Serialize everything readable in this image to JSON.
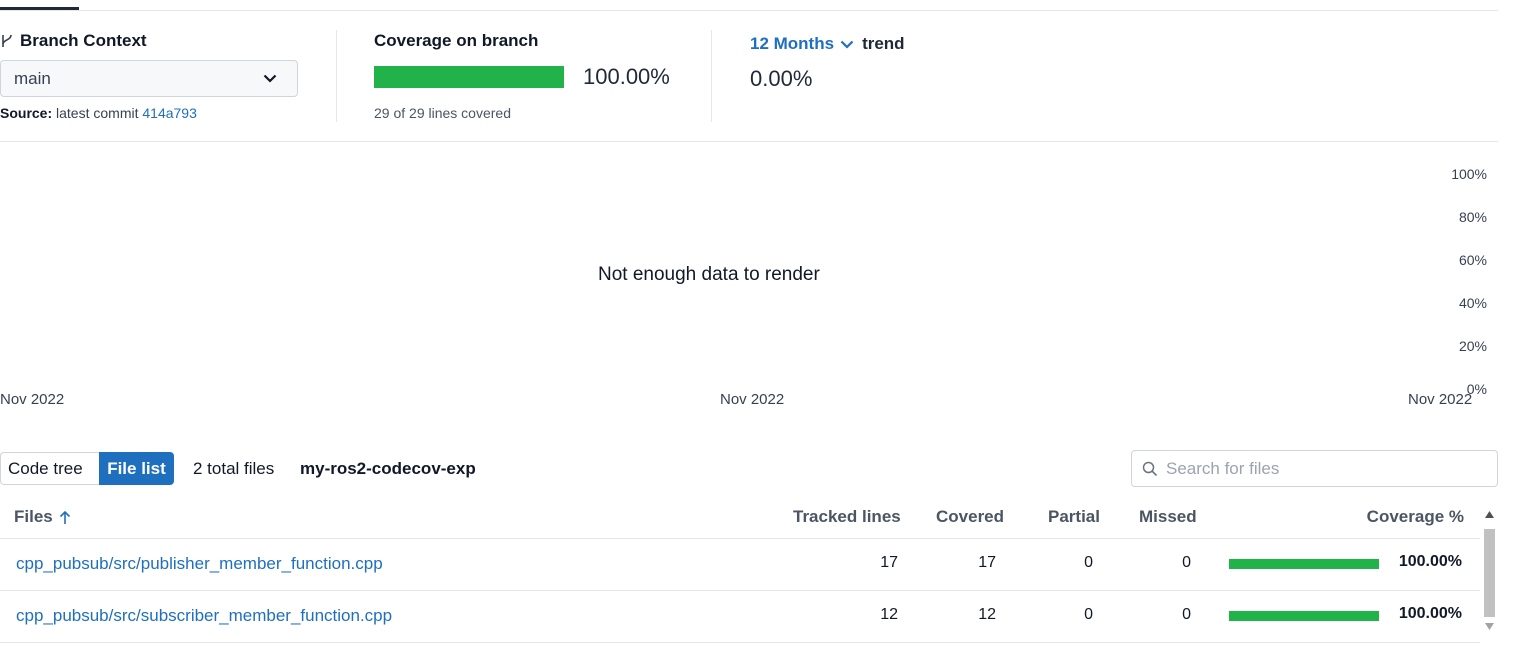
{
  "branch": {
    "label": "Branch Context",
    "selected": "main",
    "source_label": "Source:",
    "source_text": "latest commit",
    "commit": "414a793"
  },
  "coverage": {
    "label": "Coverage on branch",
    "percent_text": "100.00%",
    "percent_value": 100,
    "summary": "29 of 29 lines covered"
  },
  "trend": {
    "period": "12 Months",
    "label": "trend",
    "value": "0.00%"
  },
  "chart_data": {
    "type": "line",
    "empty_message": "Not enough data to render",
    "y_ticks": [
      "100%",
      "80%",
      "60%",
      "40%",
      "20%",
      "0%"
    ],
    "x_ticks": [
      "Nov 2022",
      "Nov 2022",
      "Nov 2022"
    ],
    "ylim": [
      0,
      100
    ],
    "series": []
  },
  "toolbar": {
    "code_tree": "Code tree",
    "file_list": "File list",
    "total_files": "2 total files",
    "repo": "my-ros2-codecov-exp",
    "search_placeholder": "Search for files"
  },
  "table": {
    "headers": {
      "files": "Files",
      "tracked": "Tracked lines",
      "covered": "Covered",
      "partial": "Partial",
      "missed": "Missed",
      "coverage": "Coverage %"
    },
    "rows": [
      {
        "file": "cpp_pubsub/src/publisher_member_function.cpp",
        "tracked": "17",
        "covered": "17",
        "partial": "0",
        "missed": "0",
        "pct_text": "100.00%",
        "pct": 100
      },
      {
        "file": "cpp_pubsub/src/subscriber_member_function.cpp",
        "tracked": "12",
        "covered": "12",
        "partial": "0",
        "missed": "0",
        "pct_text": "100.00%",
        "pct": 100
      }
    ]
  },
  "colors": {
    "accent": "#1f6fbf",
    "covered_green": "#21b34a"
  }
}
